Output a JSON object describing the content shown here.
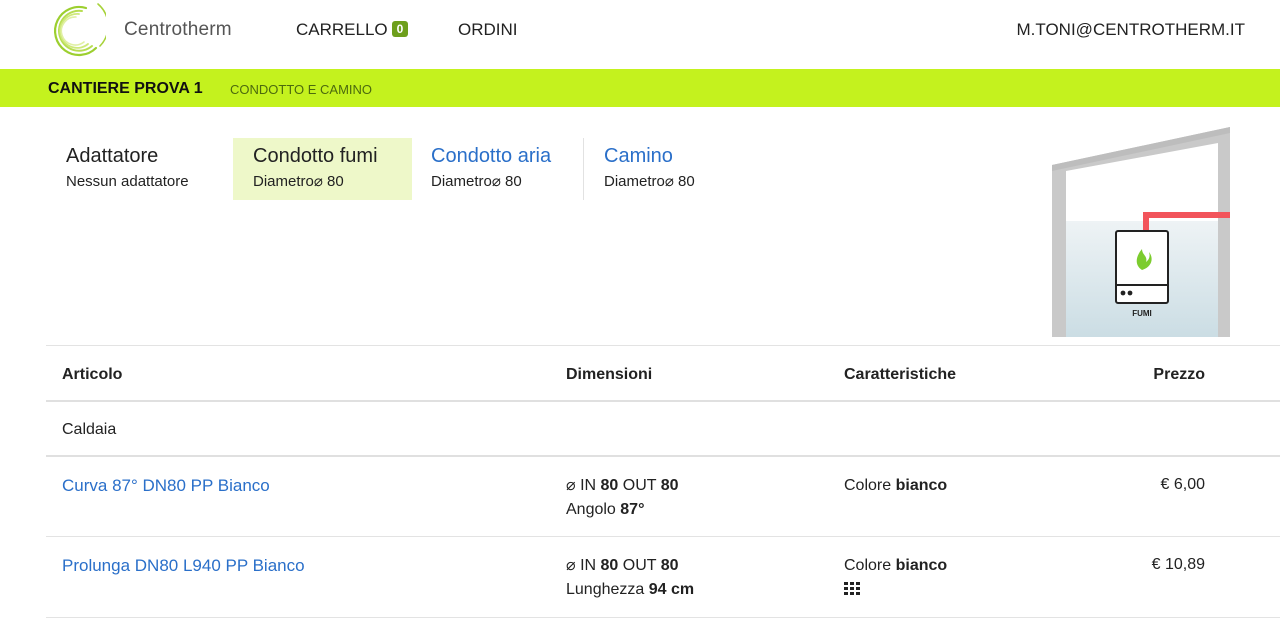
{
  "header": {
    "brand": "Centrotherm",
    "cart_label": "CARRELLO",
    "cart_count": "0",
    "orders_label": "ORDINI",
    "user_email": "M.TONI@CENTROTHERM.IT"
  },
  "band": {
    "title": "CANTIERE PROVA 1",
    "subtitle": "CONDOTTO E CAMINO"
  },
  "steps": [
    {
      "title": "Adattatore",
      "sub": "Nessun adattatore"
    },
    {
      "title": "Condotto fumi",
      "sub": "Diametro⌀ 80"
    },
    {
      "title": "Condotto aria",
      "sub": "Diametro⌀ 80"
    },
    {
      "title": "Camino",
      "sub": "Diametro⌀ 80"
    }
  ],
  "diagram": {
    "label": "FUMI",
    "colors": {
      "pipe": "#f2545b",
      "flame": "#7ccc2e",
      "wall": "#c8c8c8"
    }
  },
  "table": {
    "headers": {
      "article": "Articolo",
      "dimensions": "Dimensioni",
      "features": "Caratteristiche",
      "price": "Prezzo"
    },
    "group_label": "Caldaia",
    "rows": [
      {
        "name": "Curva 87° DN80 PP Bianco",
        "dim_prefix": "⌀ IN",
        "dim_in": "80",
        "dim_out_label": "OUT",
        "dim_out": "80",
        "dim2_label": "Angolo",
        "dim2_value": "87°",
        "feature_label": "Colore",
        "feature_value": "bianco",
        "price": "€ 6,00"
      },
      {
        "name": "Prolunga DN80 L940 PP Bianco",
        "dim_prefix": "⌀ IN",
        "dim_in": "80",
        "dim_out_label": "OUT",
        "dim_out": "80",
        "dim2_label": "Lunghezza",
        "dim2_value": "94 cm",
        "feature_label": "Colore",
        "feature_value": "bianco",
        "price": "€ 10,89"
      }
    ]
  },
  "colors": {
    "accent": "#c4f21e",
    "link": "#2a6fc9",
    "badge": "#6e9f1c"
  }
}
